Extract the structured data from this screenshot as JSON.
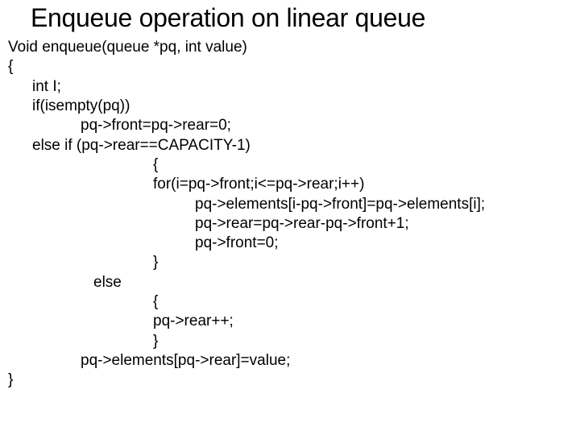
{
  "title": "Enqueue operation on linear queue",
  "code": {
    "line1": "Void enqueue(queue *pq, int value)",
    "line2": "{",
    "line3": "int I;",
    "line4": "if(isempty(pq))",
    "line5": "pq->front=pq->rear=0;",
    "line6": "else if (pq->rear==CAPACITY-1)",
    "line7": "{",
    "line8": "for(i=pq->front;i<=pq->rear;i++)",
    "line9": "pq->elements[i-pq->front]=pq->elements[i];",
    "line10": "pq->rear=pq->rear-pq->front+1;",
    "line11": "pq->front=0;",
    "line12": "}",
    "line13": "else",
    "line14": "{",
    "line15": "pq->rear++;",
    "line16": "}",
    "line17": "pq->elements[pq->rear]=value;",
    "line18": "}"
  }
}
